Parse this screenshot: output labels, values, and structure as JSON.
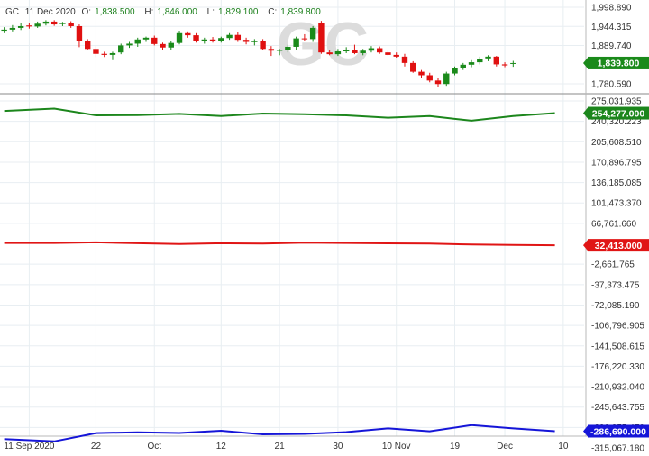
{
  "symbol": {
    "ticker": "GC",
    "date": "11 Dec 2020",
    "open_label": "O:",
    "open": "1,838.500",
    "high_label": "H:",
    "high": "1,846.000",
    "low_label": "L:",
    "low": "1,829.100",
    "close_label": "C:",
    "close": "1,839.800",
    "watermark": "GC"
  },
  "colors": {
    "up": "#1a8a1a",
    "down": "#e01010",
    "green_line": "#1c861c",
    "red_line": "#e01515",
    "blue_line": "#1515d8",
    "grid": "#e8eef2",
    "axis_text": "#333333"
  },
  "chart_data": [
    {
      "type": "candlestick",
      "panel": "price",
      "y_ticks": [
        1998.89,
        1944.315,
        1889.74,
        1780.59
      ],
      "y_tick_labels": [
        "1,998.890",
        "1,944.315",
        "1,889.740",
        "1,780.590"
      ],
      "last_value_label": "1,839.800",
      "candles": [
        {
          "o": 1932,
          "h": 1942,
          "l": 1925,
          "c": 1935
        },
        {
          "o": 1935,
          "h": 1948,
          "l": 1930,
          "c": 1940
        },
        {
          "o": 1940,
          "h": 1955,
          "l": 1934,
          "c": 1945
        },
        {
          "o": 1947,
          "h": 1953,
          "l": 1938,
          "c": 1944
        },
        {
          "o": 1944,
          "h": 1958,
          "l": 1940,
          "c": 1952
        },
        {
          "o": 1952,
          "h": 1962,
          "l": 1947,
          "c": 1958
        },
        {
          "o": 1958,
          "h": 1962,
          "l": 1946,
          "c": 1950
        },
        {
          "o": 1951,
          "h": 1957,
          "l": 1945,
          "c": 1954
        },
        {
          "o": 1955,
          "h": 1959,
          "l": 1940,
          "c": 1945
        },
        {
          "o": 1945,
          "h": 1950,
          "l": 1885,
          "c": 1902
        },
        {
          "o": 1902,
          "h": 1908,
          "l": 1878,
          "c": 1880
        },
        {
          "o": 1880,
          "h": 1888,
          "l": 1856,
          "c": 1866
        },
        {
          "o": 1866,
          "h": 1872,
          "l": 1857,
          "c": 1863
        },
        {
          "o": 1863,
          "h": 1872,
          "l": 1848,
          "c": 1868
        },
        {
          "o": 1870,
          "h": 1895,
          "l": 1865,
          "c": 1890
        },
        {
          "o": 1890,
          "h": 1900,
          "l": 1883,
          "c": 1895
        },
        {
          "o": 1895,
          "h": 1912,
          "l": 1886,
          "c": 1907
        },
        {
          "o": 1907,
          "h": 1915,
          "l": 1900,
          "c": 1912
        },
        {
          "o": 1912,
          "h": 1918,
          "l": 1890,
          "c": 1894
        },
        {
          "o": 1894,
          "h": 1898,
          "l": 1878,
          "c": 1884
        },
        {
          "o": 1884,
          "h": 1902,
          "l": 1878,
          "c": 1897
        },
        {
          "o": 1897,
          "h": 1932,
          "l": 1893,
          "c": 1925
        },
        {
          "o": 1925,
          "h": 1930,
          "l": 1912,
          "c": 1919
        },
        {
          "o": 1919,
          "h": 1925,
          "l": 1898,
          "c": 1902
        },
        {
          "o": 1902,
          "h": 1912,
          "l": 1895,
          "c": 1907
        },
        {
          "o": 1907,
          "h": 1914,
          "l": 1898,
          "c": 1903
        },
        {
          "o": 1903,
          "h": 1915,
          "l": 1898,
          "c": 1911
        },
        {
          "o": 1911,
          "h": 1925,
          "l": 1906,
          "c": 1920
        },
        {
          "o": 1920,
          "h": 1928,
          "l": 1900,
          "c": 1906
        },
        {
          "o": 1906,
          "h": 1912,
          "l": 1893,
          "c": 1900
        },
        {
          "o": 1900,
          "h": 1908,
          "l": 1890,
          "c": 1902
        },
        {
          "o": 1902,
          "h": 1908,
          "l": 1878,
          "c": 1880
        },
        {
          "o": 1880,
          "h": 1888,
          "l": 1860,
          "c": 1875
        },
        {
          "o": 1875,
          "h": 1880,
          "l": 1862,
          "c": 1877
        },
        {
          "o": 1877,
          "h": 1892,
          "l": 1870,
          "c": 1886
        },
        {
          "o": 1886,
          "h": 1915,
          "l": 1878,
          "c": 1910
        },
        {
          "o": 1910,
          "h": 1922,
          "l": 1902,
          "c": 1908
        },
        {
          "o": 1908,
          "h": 1945,
          "l": 1900,
          "c": 1940
        },
        {
          "o": 1955,
          "h": 1960,
          "l": 1866,
          "c": 1870
        },
        {
          "o": 1870,
          "h": 1878,
          "l": 1862,
          "c": 1865
        },
        {
          "o": 1865,
          "h": 1880,
          "l": 1860,
          "c": 1873
        },
        {
          "o": 1873,
          "h": 1885,
          "l": 1868,
          "c": 1878
        },
        {
          "o": 1878,
          "h": 1892,
          "l": 1865,
          "c": 1868
        },
        {
          "o": 1868,
          "h": 1880,
          "l": 1862,
          "c": 1875
        },
        {
          "o": 1875,
          "h": 1888,
          "l": 1870,
          "c": 1882
        },
        {
          "o": 1882,
          "h": 1887,
          "l": 1866,
          "c": 1870
        },
        {
          "o": 1870,
          "h": 1875,
          "l": 1860,
          "c": 1863
        },
        {
          "o": 1863,
          "h": 1870,
          "l": 1855,
          "c": 1858
        },
        {
          "o": 1858,
          "h": 1866,
          "l": 1830,
          "c": 1840
        },
        {
          "o": 1840,
          "h": 1845,
          "l": 1812,
          "c": 1815
        },
        {
          "o": 1815,
          "h": 1820,
          "l": 1798,
          "c": 1805
        },
        {
          "o": 1805,
          "h": 1812,
          "l": 1785,
          "c": 1790
        },
        {
          "o": 1790,
          "h": 1798,
          "l": 1772,
          "c": 1780
        },
        {
          "o": 1780,
          "h": 1815,
          "l": 1775,
          "c": 1810
        },
        {
          "o": 1810,
          "h": 1830,
          "l": 1805,
          "c": 1826
        },
        {
          "o": 1826,
          "h": 1840,
          "l": 1820,
          "c": 1835
        },
        {
          "o": 1835,
          "h": 1848,
          "l": 1828,
          "c": 1842
        },
        {
          "o": 1842,
          "h": 1858,
          "l": 1836,
          "c": 1852
        },
        {
          "o": 1853,
          "h": 1862,
          "l": 1845,
          "c": 1858
        },
        {
          "o": 1858,
          "h": 1860,
          "l": 1830,
          "c": 1836
        },
        {
          "o": 1836,
          "h": 1842,
          "l": 1828,
          "c": 1833
        },
        {
          "o": 1838.5,
          "h": 1846,
          "l": 1829.1,
          "c": 1839.8
        }
      ]
    },
    {
      "type": "line",
      "panel": "lower",
      "y_ticks": [
        275031.935,
        240320.123,
        205608.51,
        170896.795,
        136185.085,
        101473.37,
        66761.66,
        -2661.765,
        -37373.475,
        -72085.19,
        -106796.905,
        -141508.615,
        -176220.33,
        -210932.04,
        -245643.755,
        -280355.47,
        -315067.18
      ],
      "y_tick_labels": [
        "275,031.935",
        "240,320.223",
        "205,608.510",
        "170,896.795",
        "136,185.085",
        "101,473.370",
        "66,761.660",
        "-2,661.765",
        "-37,373.475",
        "-72,085.190",
        "-106,796.905",
        "-141,508.615",
        "-176,220.330",
        "-210,932.040",
        "-245,643.755",
        "-280,355.470",
        "-315,067.180"
      ],
      "series": [
        {
          "color_key": "green_line",
          "last_value_label": "254,277.000",
          "values": [
            [
              0,
              258000
            ],
            [
              6,
              262000
            ],
            [
              11,
              250500
            ],
            [
              16,
              251000
            ],
            [
              21,
              253000
            ],
            [
              26,
              249500
            ],
            [
              31,
              253500
            ],
            [
              36,
              252500
            ],
            [
              41,
              250500
            ],
            [
              46,
              246500
            ],
            [
              51,
              249500
            ],
            [
              56,
              241500
            ],
            [
              61,
              249500
            ],
            [
              66,
              254277
            ]
          ]
        },
        {
          "color_key": "red_line",
          "last_value_label": "32,413.000",
          "values": [
            [
              0,
              33500
            ],
            [
              6,
              33500
            ],
            [
              11,
              34500
            ],
            [
              16,
              33000
            ],
            [
              21,
              31800
            ],
            [
              26,
              33000
            ],
            [
              31,
              32600
            ],
            [
              36,
              34000
            ],
            [
              41,
              33500
            ],
            [
              46,
              32800
            ],
            [
              51,
              32600
            ],
            [
              56,
              30800
            ],
            [
              61,
              30200
            ],
            [
              66,
              29600
            ]
          ]
        },
        {
          "color_key": "blue_line",
          "last_value_label": "-286,690.000",
          "values": [
            [
              0,
              -300000
            ],
            [
              6,
              -304000
            ],
            [
              11,
              -290000
            ],
            [
              16,
              -288500
            ],
            [
              21,
              -289800
            ],
            [
              26,
              -286000
            ],
            [
              31,
              -292000
            ],
            [
              36,
              -291300
            ],
            [
              41,
              -288200
            ],
            [
              46,
              -282000
            ],
            [
              51,
              -286800
            ],
            [
              56,
              -276500
            ],
            [
              61,
              -282000
            ],
            [
              66,
              -286690
            ]
          ]
        }
      ]
    }
  ],
  "x_axis": {
    "labels": [
      {
        "i": 3,
        "text": "11 Sep 2020"
      },
      {
        "i": 11,
        "text": "22"
      },
      {
        "i": 18,
        "text": "Oct"
      },
      {
        "i": 26,
        "text": "12"
      },
      {
        "i": 33,
        "text": "21"
      },
      {
        "i": 40,
        "text": "30"
      },
      {
        "i": 47,
        "text": "10 Nov"
      },
      {
        "i": 54,
        "text": "19"
      },
      {
        "i": 60,
        "text": "Dec"
      },
      {
        "i": 67,
        "text": "10"
      }
    ],
    "total_slots": 70
  }
}
